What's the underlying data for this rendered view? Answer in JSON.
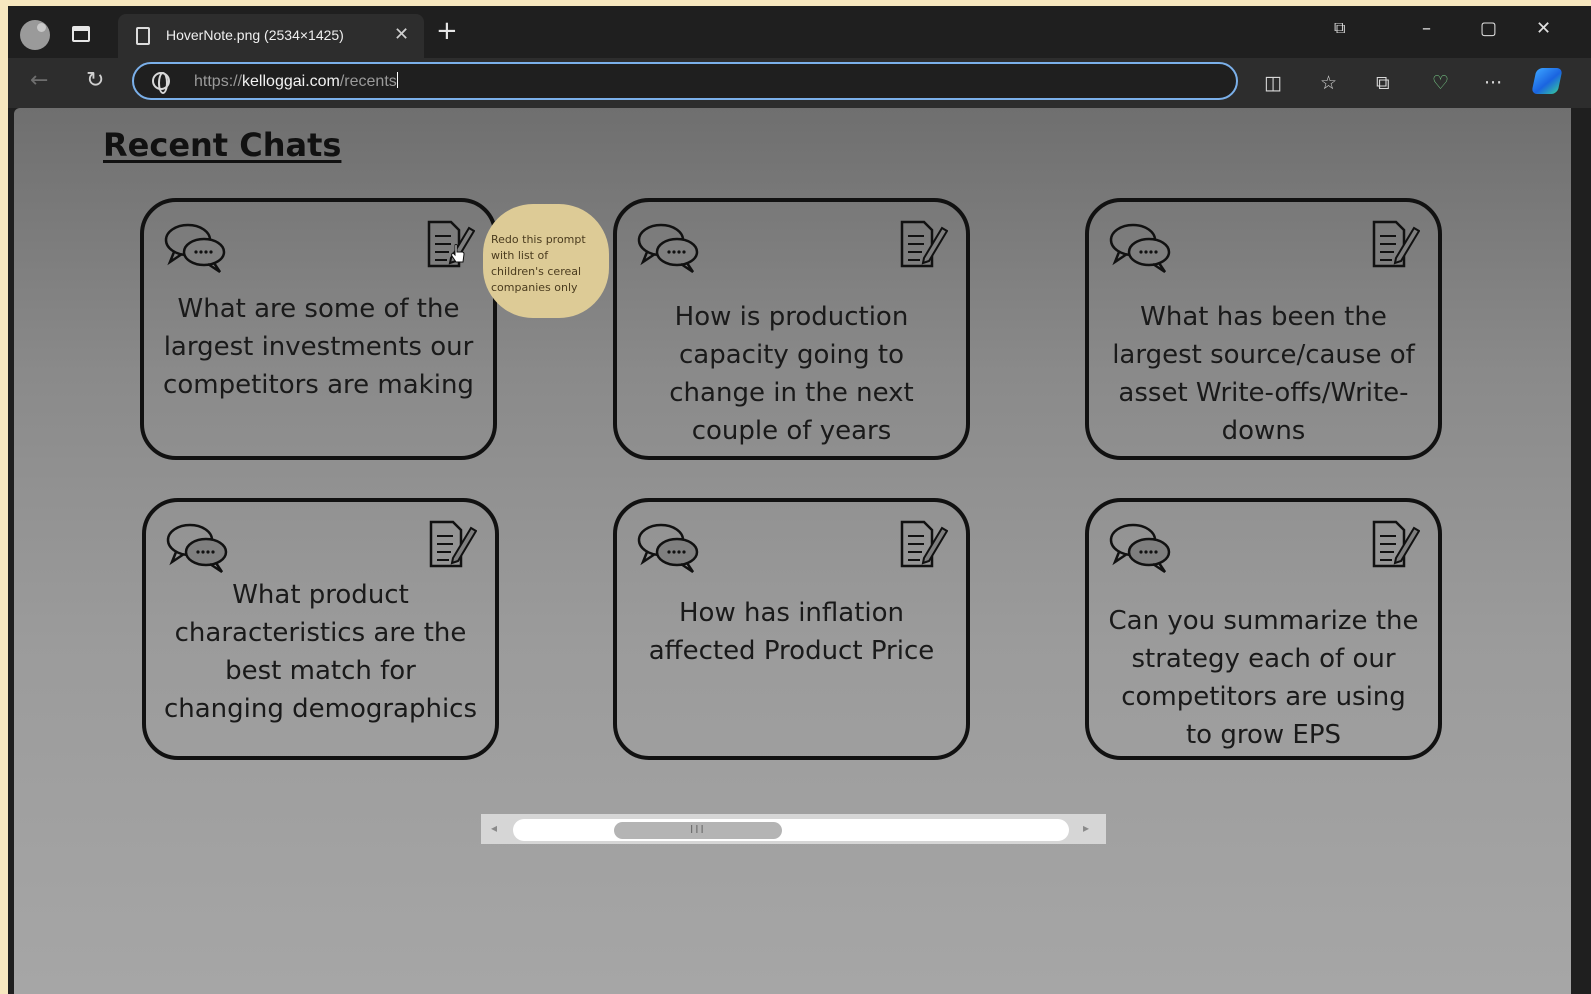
{
  "browser": {
    "tab_title": "HoverNote.png (2534×1425)",
    "tab_close": "✕",
    "new_tab": "+",
    "url_scheme": "https://",
    "url_host": "kelloggai.com",
    "url_path": "/recents",
    "icons": [
      "profile-icon",
      "tab-actions-icon",
      "document-icon",
      "back-icon",
      "refresh-icon",
      "globe-icon",
      "split-screen-icon",
      "favorites-icon",
      "collections-icon",
      "browser-essentials-icon",
      "more-icon",
      "copilot-icon"
    ],
    "window": {
      "minimize": "–",
      "maximize": "▢",
      "close": "✕"
    },
    "toolbar": {
      "back": "←",
      "refresh": "↻",
      "split": "◫",
      "favorites": "☆",
      "collections": "⧉",
      "essentials": "♡",
      "more": "···"
    }
  },
  "page": {
    "title": "Recent Chats",
    "cards": [
      {
        "text": "What are some of the largest investments our competitors are making"
      },
      {
        "text": "How is production capacity going to change in the next couple of years"
      },
      {
        "text": "What has been the largest source/cause of asset Write-offs/Write-downs"
      },
      {
        "text": "What product characteristics are the best match for changing demographics"
      },
      {
        "text": "How has inflation affected Product Price"
      },
      {
        "text": "Can you summarize the strategy each of our competitors are using to grow EPS"
      }
    ],
    "hover_note": "Redo this prompt with list of children's cereal companies only",
    "scrollbar": {
      "left_arrow": "◂",
      "right_arrow": "▸",
      "grip": "III"
    }
  },
  "colors": {
    "accent_border": "#7bb0ea",
    "tooltip_bg": "#ddcb96",
    "card_border": "#111111"
  }
}
